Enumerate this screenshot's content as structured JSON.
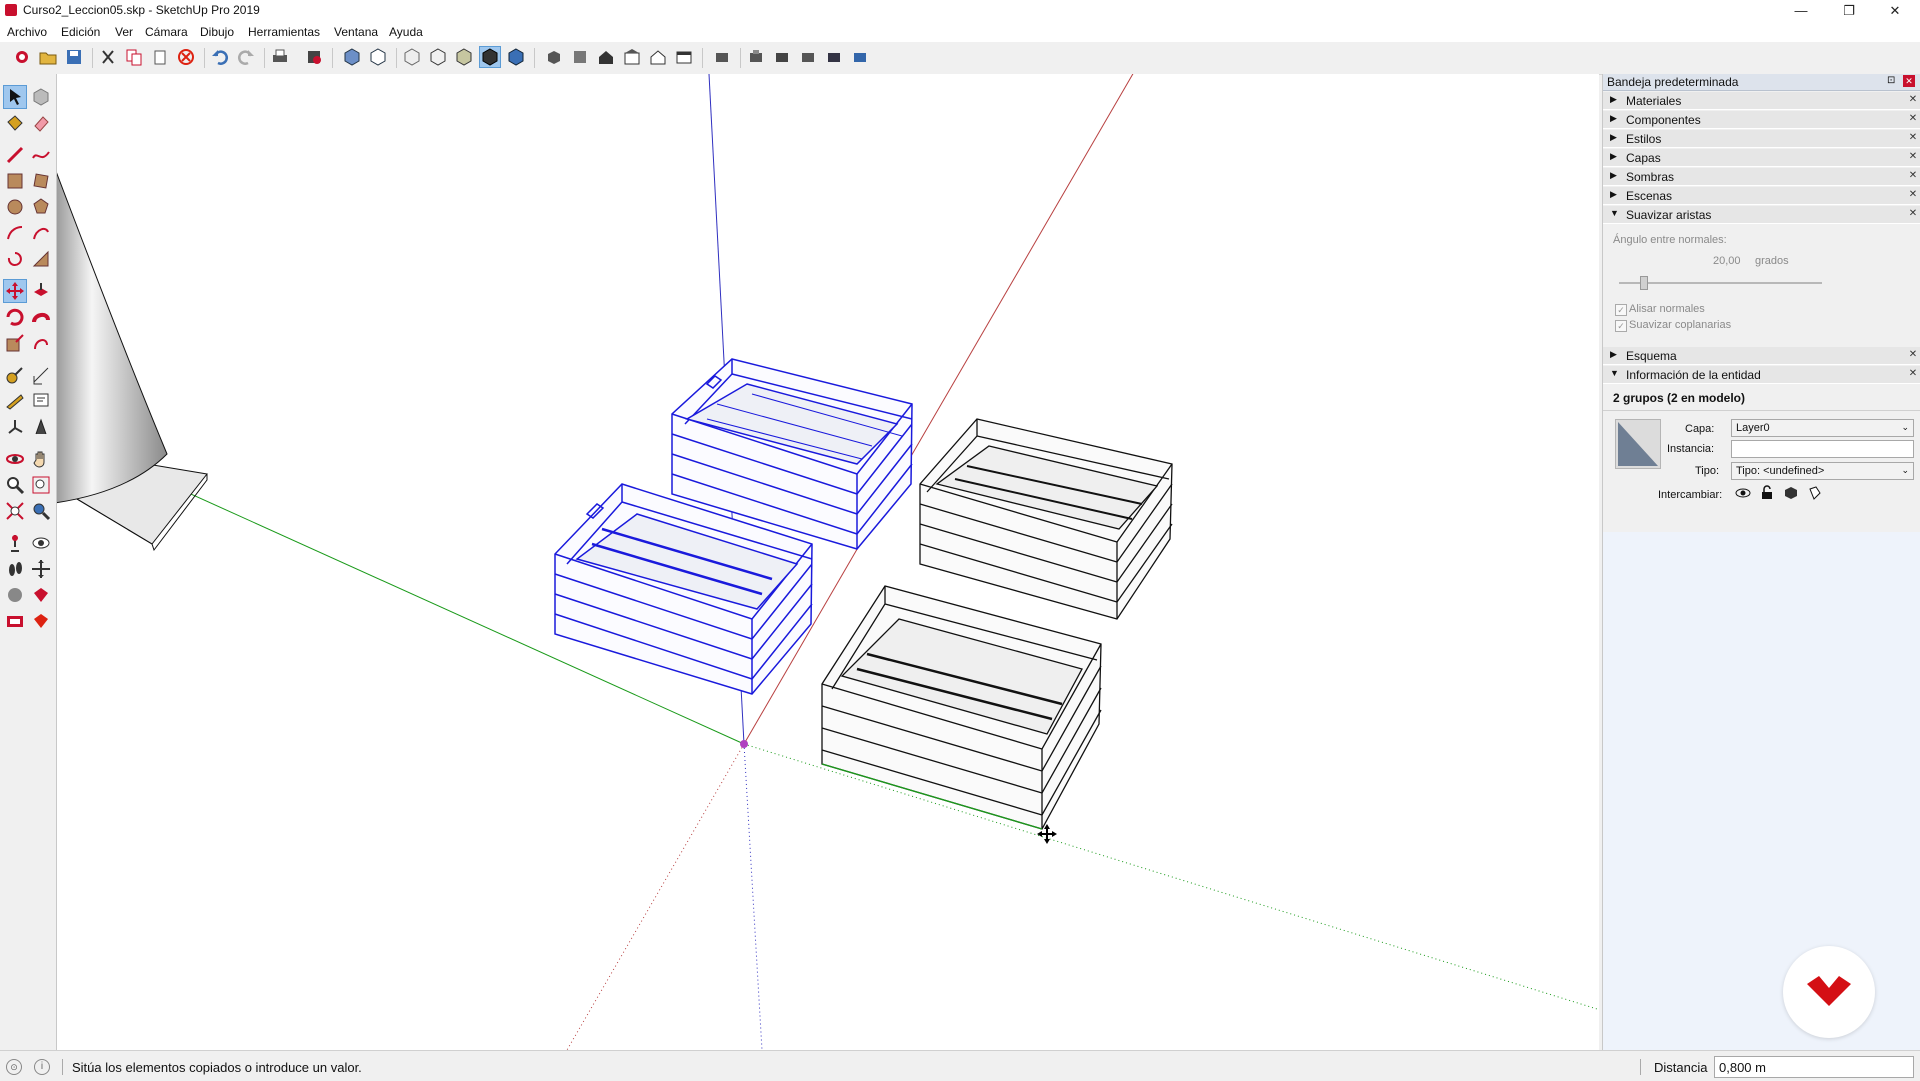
{
  "window": {
    "title": "Curso2_Leccion05.skp - SketchUp Pro 2019",
    "minimize": "—",
    "restore": "❐",
    "close": "✕"
  },
  "menu": {
    "items": [
      "Archivo",
      "Edición",
      "Ver",
      "Cámara",
      "Dibujo",
      "Herramientas",
      "Ventana",
      "Ayuda"
    ]
  },
  "tray": {
    "title": "Bandeja predeterminada",
    "pin": "⊡",
    "close": "✕",
    "panels": {
      "materiales": "Materiales",
      "componentes": "Componentes",
      "estilos": "Estilos",
      "capas": "Capas",
      "sombras": "Sombras",
      "escenas": "Escenas",
      "suavizar": "Suavizar aristas",
      "esquema": "Esquema",
      "entidad": "Información de la entidad"
    },
    "suavizar": {
      "angle_label": "Ángulo entre normales:",
      "angle_value": "20,00",
      "angle_unit": "grados",
      "slider_level": 0.12,
      "alisar": "Alisar normales",
      "coplanarias": "Suavizar coplanarias",
      "check": "✓"
    },
    "entity": {
      "heading": "2 grupos (2 en modelo)",
      "capa_label": "Capa:",
      "capa_value": "Layer0",
      "instancia_label": "Instancia:",
      "instancia_value": "",
      "tipo_label": "Tipo:",
      "tipo_value": "Tipo: <undefined>",
      "intercambiar_label": "Intercambiar:"
    }
  },
  "status": {
    "message": "Sitúa los elementos copiados o introduce un valor.",
    "measure_label": "Distancia",
    "measure_value": "0,800 m"
  },
  "colors": {
    "selected": "#1a1adc",
    "accent": "#c8102e"
  }
}
